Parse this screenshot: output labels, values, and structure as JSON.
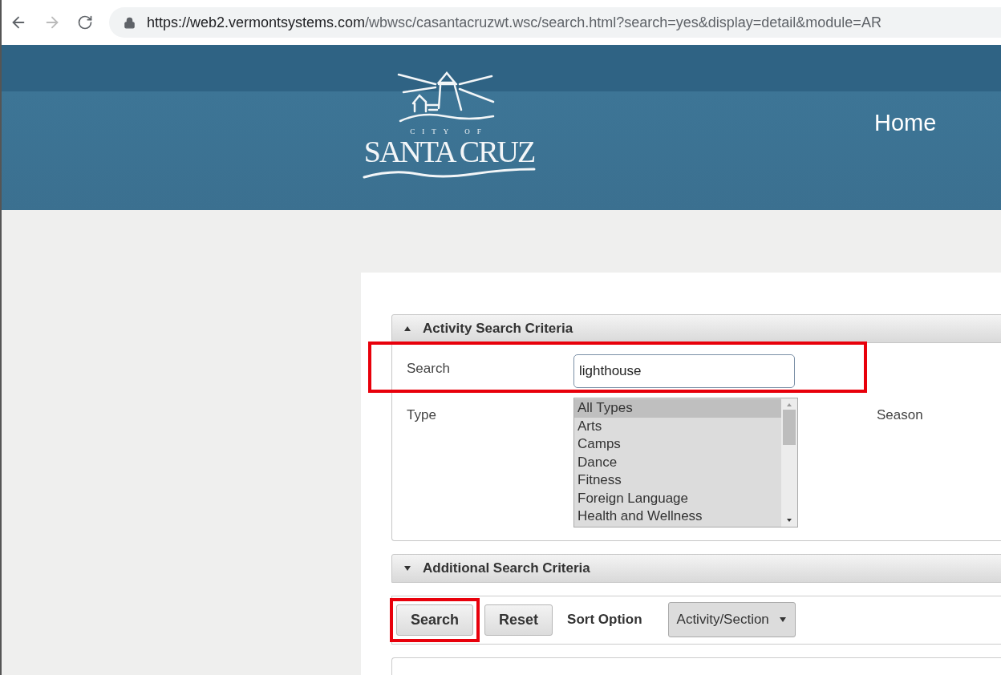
{
  "browser": {
    "url_host": "https://web2.vermontsystems.com",
    "url_path": "/wbwsc/casantacruzwt.wsc/search.html?search=yes&display=detail&module=AR"
  },
  "header": {
    "logo_small": "CITY OF",
    "logo_large": "SANTA CRUZ",
    "nav": [
      "Home"
    ]
  },
  "criteria_panel": {
    "title": "Activity Search Criteria",
    "expanded": true,
    "search": {
      "label": "Search",
      "value": "lighthouse",
      "highlighted": true
    },
    "type": {
      "label": "Type",
      "options": [
        {
          "label": "All Types",
          "selected": true
        },
        {
          "label": "Arts",
          "selected": false
        },
        {
          "label": "Camps",
          "selected": false
        },
        {
          "label": "Dance",
          "selected": false
        },
        {
          "label": "Fitness",
          "selected": false
        },
        {
          "label": "Foreign Language",
          "selected": false
        },
        {
          "label": "Health and Wellness",
          "selected": false
        }
      ]
    },
    "season": {
      "label": "Season"
    }
  },
  "additional_panel": {
    "title": "Additional Search Criteria",
    "expanded": false
  },
  "actions": {
    "buttons": [
      {
        "label": "Search",
        "highlighted": true
      },
      {
        "label": "Reset",
        "highlighted": false
      }
    ],
    "sort_label": "Sort Option",
    "sort_value": "Activity/Section"
  }
}
